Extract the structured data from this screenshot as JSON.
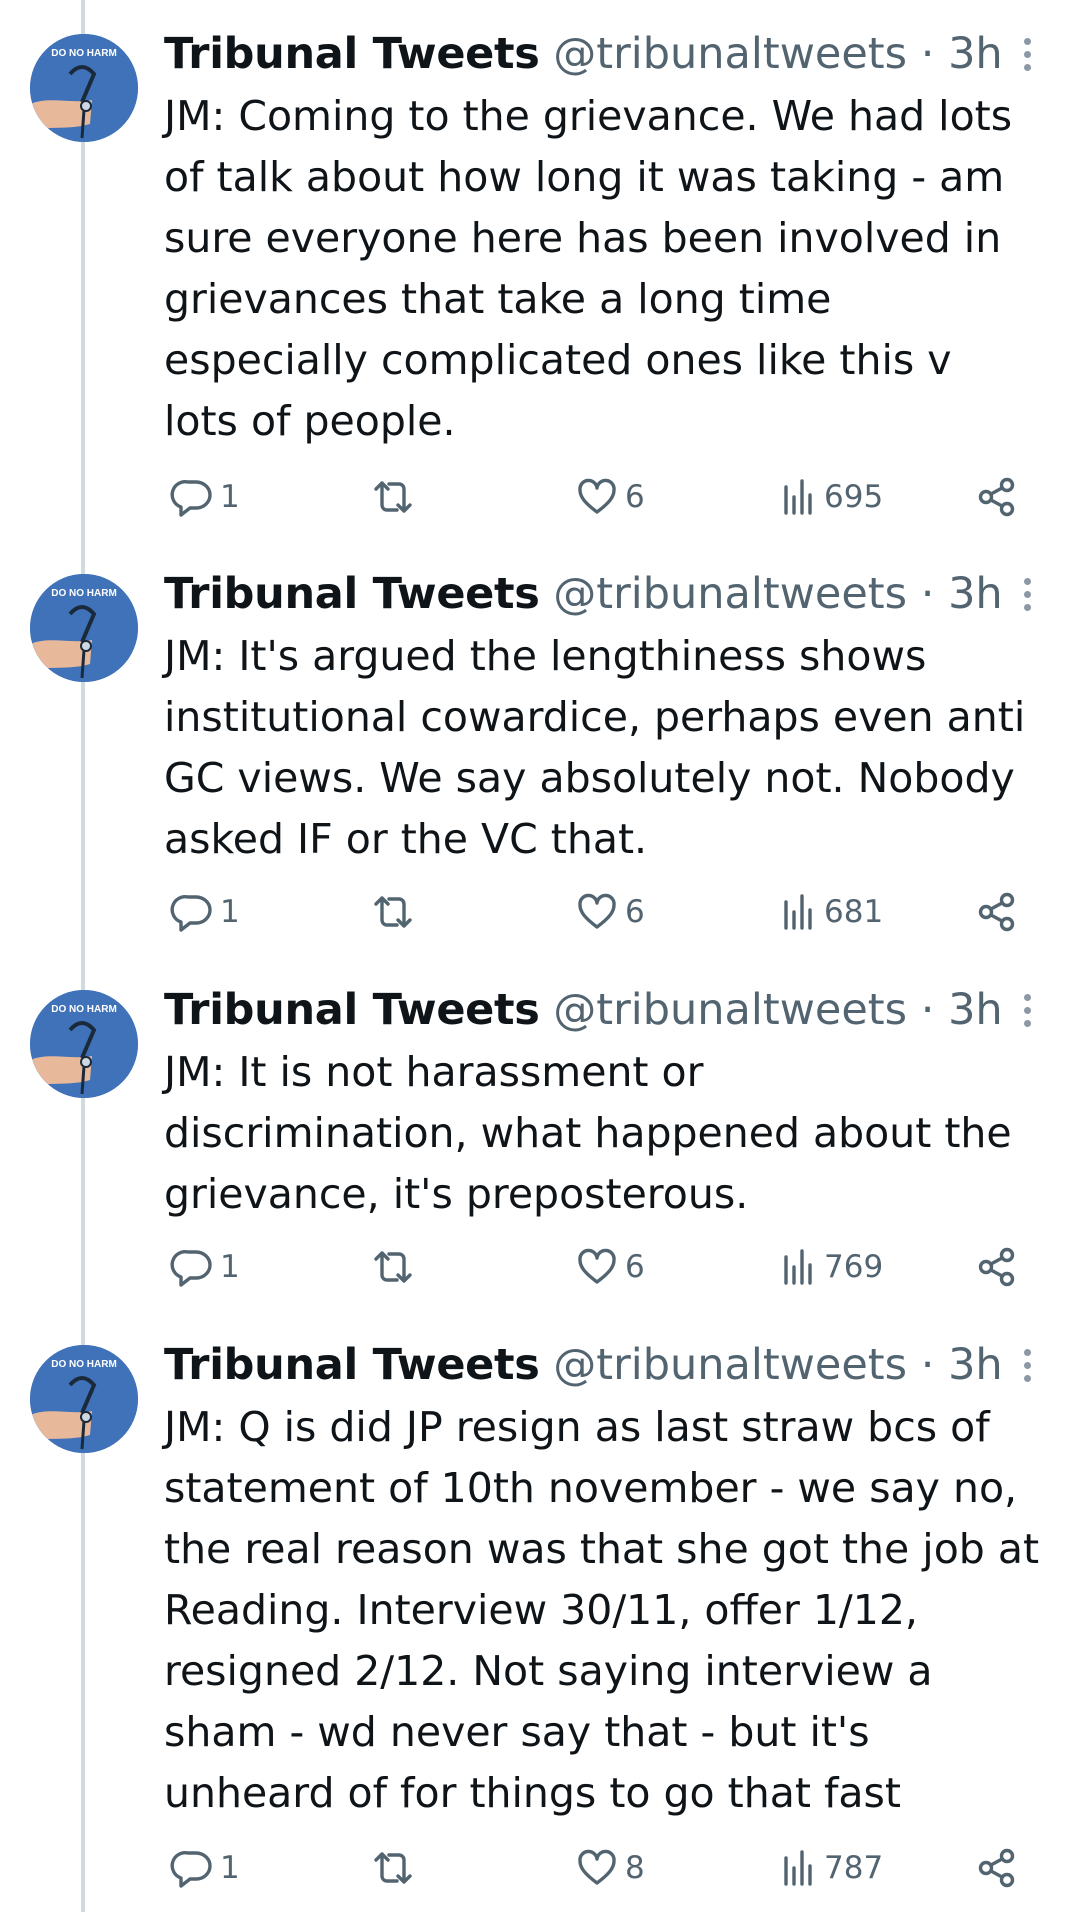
{
  "avatar_badge_text": "DO NO HARM",
  "tweets": [
    {
      "name": "Tribunal Tweets",
      "handle": "@tribunaltweets",
      "separator": "·",
      "time": "3h",
      "text": "JM: Coming to the grievance. We had lots\nof talk about how long it was taking - am\nsure everyone here has been involved in\ngrievances that take a long time\nespecially complicated ones like this v\nlots of people.",
      "replies": "1",
      "likes": "6",
      "views": "695"
    },
    {
      "name": "Tribunal Tweets",
      "handle": "@tribunaltweets",
      "separator": "·",
      "time": "3h",
      "text": "JM: It's argued the lengthiness shows\ninstitutional cowardice, perhaps even anti\nGC views. We say absolutely not. Nobody\nasked IF or the VC that.",
      "replies": "1",
      "likes": "6",
      "views": "681"
    },
    {
      "name": "Tribunal Tweets",
      "handle": "@tribunaltweets",
      "separator": "·",
      "time": "3h",
      "text": "JM:  It is not harassment or\ndiscrimination, what happened about the\ngrievance, it's preposterous.",
      "replies": "1",
      "likes": "6",
      "views": "769"
    },
    {
      "name": "Tribunal Tweets",
      "handle": "@tribunaltweets",
      "separator": "·",
      "time": "3h",
      "text": "JM: Q is did JP resign as last straw bcs of\nstatement of 10th november - we say no,\nthe real reason was that she got the job at\nReading. Interview 30/11, offer 1/12,\nresigned 2/12. Not saying interview a\nsham - wd never say that - but it's\nunheard of for things to go that fast",
      "replies": "1",
      "likes": "8",
      "views": "787"
    }
  ]
}
